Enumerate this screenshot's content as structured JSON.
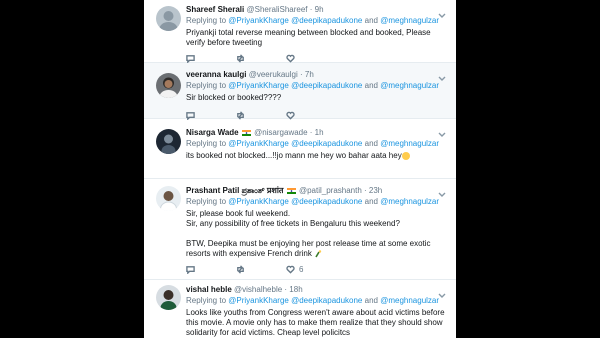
{
  "tweets": [
    {
      "name": "Shareef Sherali",
      "handle": "@SheraliShareef",
      "time": "· 9h",
      "replying_prefix": "Replying to",
      "mentions": [
        "@PriyankKharge",
        "@deepikapadukone"
      ],
      "and_word": "and",
      "last_mention": "@meghnagulzar",
      "text_lines": [
        "Priyankji  total reverse meaning between blocked and booked, Please verify before tweeting"
      ],
      "like_count": ""
    },
    {
      "name": "veeranna kaulgi",
      "handle": "@veerukaulgi",
      "time": "· 7h",
      "replying_prefix": "Replying to",
      "mentions": [
        "@PriyankKharge",
        "@deepikapadukone"
      ],
      "and_word": "and",
      "last_mention": "@meghnagulzar",
      "text_lines": [
        "Sir blocked or booked????"
      ],
      "like_count": ""
    },
    {
      "name": "Nisarga Wade",
      "handle": "@nisargawade",
      "time": "· 1h",
      "replying_prefix": "Replying to",
      "mentions": [
        "@PriyankKharge",
        "@deepikapadukone"
      ],
      "and_word": "and",
      "last_mention": "@meghnagulzar",
      "text_lines": [
        "its booked not blocked...!!jo mann me hey wo bahar aata hey"
      ],
      "like_count": ""
    },
    {
      "name": "Prashant Patil ಪ್ರಶಾಂತ್ प्रशांत",
      "handle": "@patil_prashanth",
      "time": "· 23h",
      "replying_prefix": "Replying to",
      "mentions": [
        "@PriyankKharge",
        "@deepikapadukone"
      ],
      "and_word": "and",
      "last_mention": "@meghnagulzar",
      "text_lines": [
        "Sir, please book ful weekend.",
        "Sir, any possibility of free tickets in Bengaluru this weekend?",
        "",
        "BTW, Deepika must be enjoying her post release time at some exotic resorts with expensive French drink"
      ],
      "like_count": "6"
    },
    {
      "name": "vishal heble",
      "handle": "@vishalheble",
      "time": "· 18h",
      "replying_prefix": "Replying to",
      "mentions": [
        "@PriyankKharge",
        "@deepikapadukone"
      ],
      "and_word": "and",
      "last_mention": "@meghnagulzar",
      "text_lines": [
        "Looks like youths from Congress weren't aware about acid victims before this movie. A movie only has to make them realize that they should show solidarity for acid victims. Cheap level policitcs"
      ],
      "like_count": ""
    }
  ],
  "colors": {
    "link": "#1b95e0",
    "muted": "#657786",
    "text": "#14171a"
  },
  "icons": [
    "reply-icon",
    "retweet-icon",
    "like-icon",
    "caret-down-icon"
  ]
}
